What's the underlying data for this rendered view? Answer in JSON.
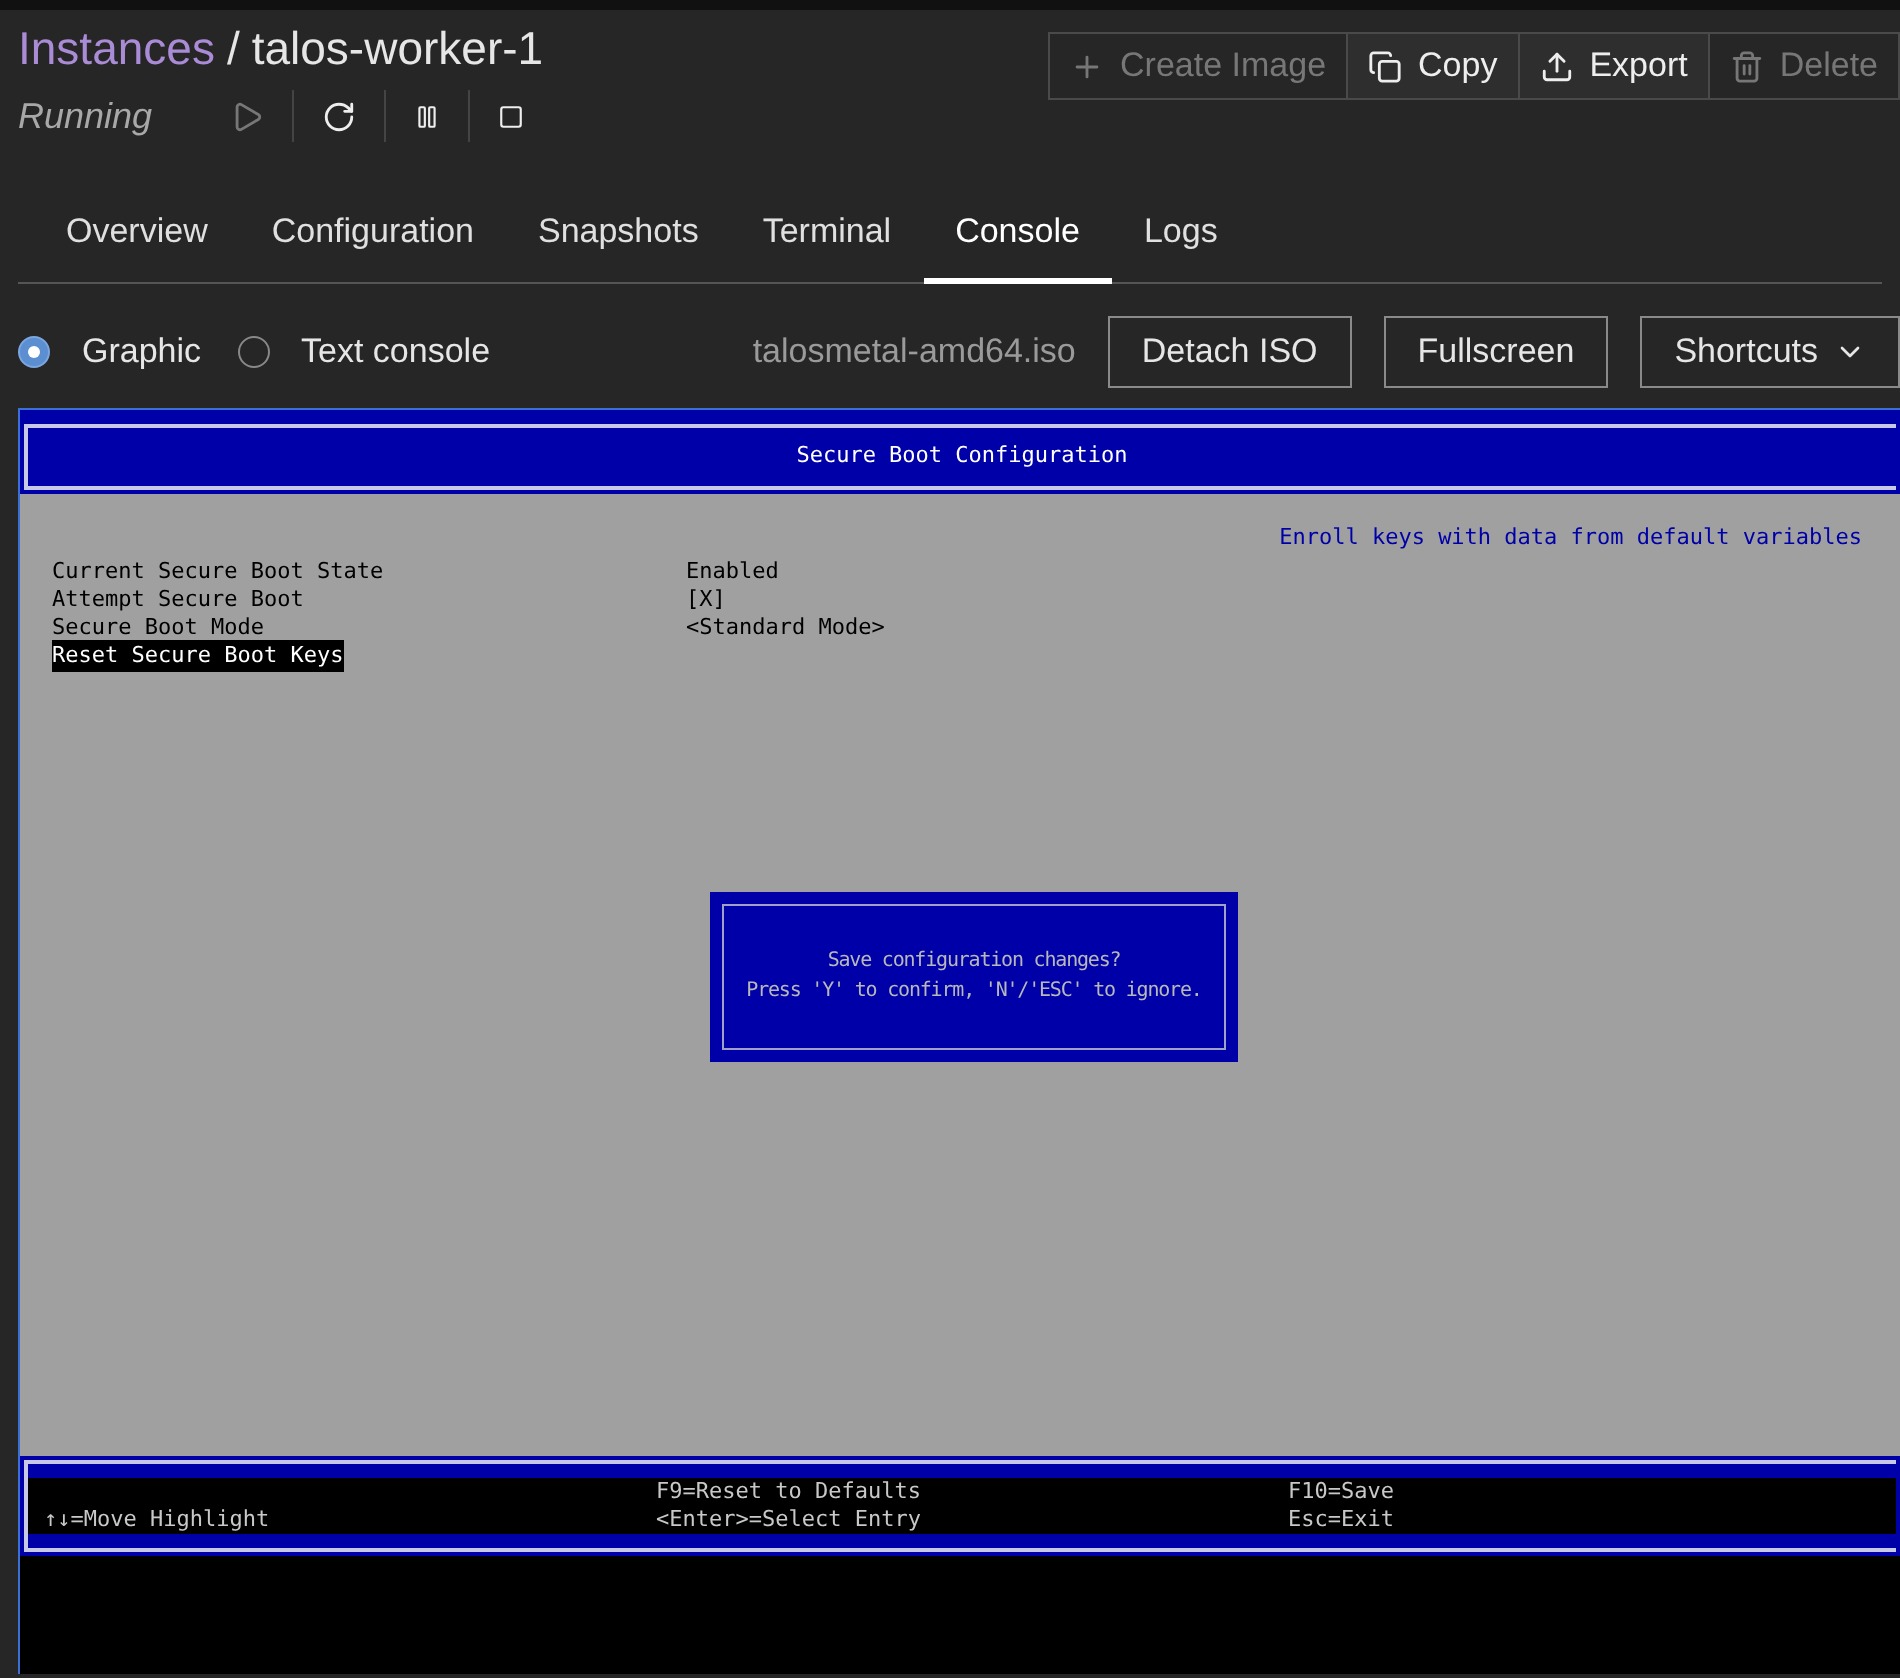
{
  "breadcrumb": {
    "parent": "Instances",
    "separator": "/",
    "current": "talos-worker-1"
  },
  "status": "Running",
  "controls": [
    {
      "kind": "play",
      "disabled": true
    },
    {
      "kind": "restart",
      "disabled": false
    },
    {
      "kind": "pause",
      "disabled": false
    },
    {
      "kind": "stop",
      "disabled": false
    }
  ],
  "actions": [
    {
      "label": "Create Image",
      "kind": "create",
      "disabled": true
    },
    {
      "label": "Copy",
      "kind": "copy",
      "disabled": false
    },
    {
      "label": "Export",
      "kind": "export",
      "disabled": false
    },
    {
      "label": "Delete",
      "kind": "delete",
      "disabled": true
    }
  ],
  "tabs": [
    {
      "label": "Overview",
      "selected": false
    },
    {
      "label": "Configuration",
      "selected": false
    },
    {
      "label": "Snapshots",
      "selected": false
    },
    {
      "label": "Terminal",
      "selected": false
    },
    {
      "label": "Console",
      "selected": true
    },
    {
      "label": "Logs",
      "selected": false
    }
  ],
  "console_modes": [
    {
      "label": "Graphic",
      "selected": true
    },
    {
      "label": "Text console",
      "selected": false
    }
  ],
  "iso": "talosmetal-amd64.iso",
  "console_buttons": [
    {
      "label": "Detach ISO",
      "kind": "plain"
    },
    {
      "label": "Fullscreen",
      "kind": "plain"
    },
    {
      "label": "Shortcuts",
      "kind": "dropdown"
    }
  ],
  "screen": {
    "title": "Secure Boot Configuration",
    "help": "Enroll keys with data from default variables",
    "items": [
      {
        "label": "Current Secure Boot State",
        "value": "Enabled",
        "selected": false
      },
      {
        "label": "Attempt Secure Boot",
        "value": "[X]",
        "selected": false
      },
      {
        "label": "Secure Boot Mode",
        "value": "<Standard Mode>",
        "selected": false
      },
      {
        "label": "Reset Secure Boot Keys",
        "selected": true
      }
    ],
    "dialog": [
      "Save configuration changes?",
      "Press 'Y' to confirm, 'N'/'ESC' to ignore."
    ],
    "footer": [
      [
        "↑↓=Move Highlight"
      ],
      [
        "F9=Reset to Defaults",
        "<Enter>=Select Entry"
      ],
      [
        "F10=Save",
        "Esc=Exit"
      ]
    ]
  }
}
